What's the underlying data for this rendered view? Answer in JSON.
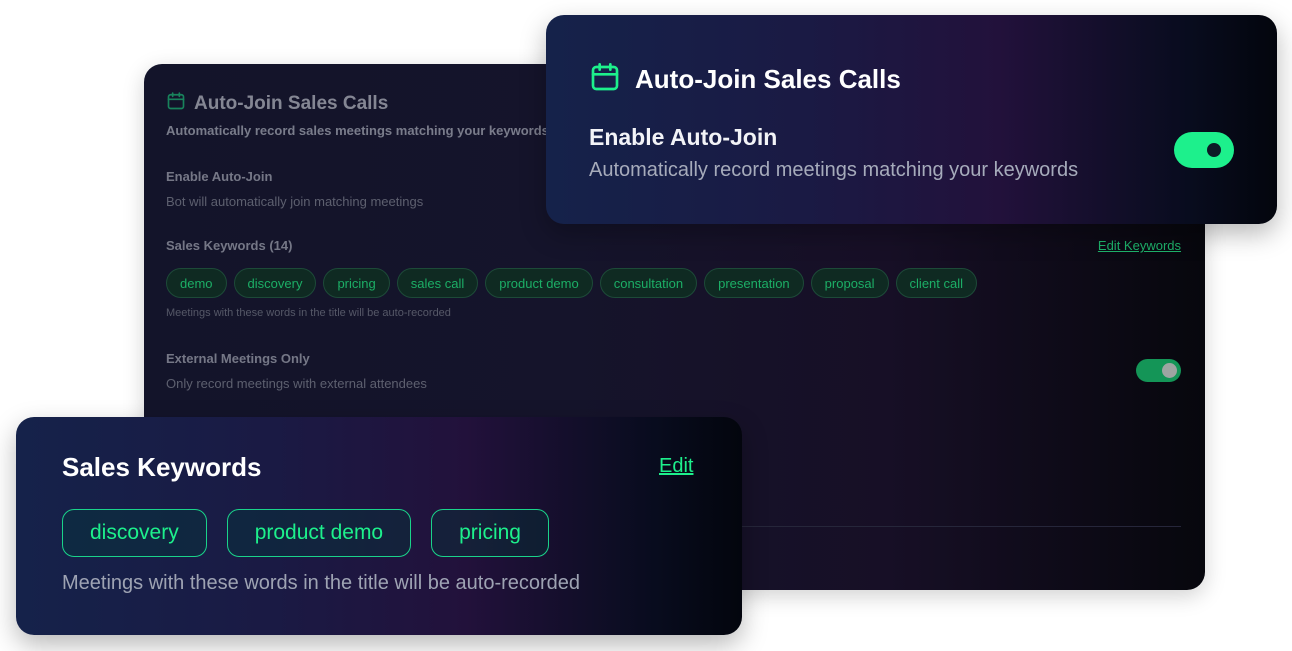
{
  "main_card": {
    "title": "Auto-Join Sales Calls",
    "subtitle": "Automatically record sales meetings matching your keywords",
    "enable": {
      "label": "Enable Auto-Join",
      "description": "Bot will automatically join matching meetings"
    },
    "keywords": {
      "label": "Sales Keywords (14)",
      "edit_link": "Edit Keywords",
      "chips": [
        "demo",
        "discovery",
        "pricing",
        "sales call",
        "product demo",
        "consultation",
        "presentation",
        "proposal",
        "client call"
      ],
      "hint": "Meetings with these words in the title will be auto-recorded"
    },
    "external": {
      "label": "External Meetings Only",
      "description": "Only record meetings with external attendees",
      "toggle_on": true
    }
  },
  "top_card": {
    "title": "Auto-Join Sales Calls",
    "label": "Enable Auto-Join",
    "description": "Automatically record meetings matching your keywords",
    "toggle_on": true
  },
  "bottom_card": {
    "title": "Sales Keywords",
    "edit_link": "Edit",
    "chips": [
      "discovery",
      "product demo",
      "pricing"
    ],
    "hint": "Meetings with these words in the title will be auto-recorded"
  },
  "colors": {
    "accent_green": "#1df08c",
    "muted_green": "#1cae66",
    "card_dark": "#13142a"
  },
  "icons": {
    "calendar": "calendar-icon"
  }
}
